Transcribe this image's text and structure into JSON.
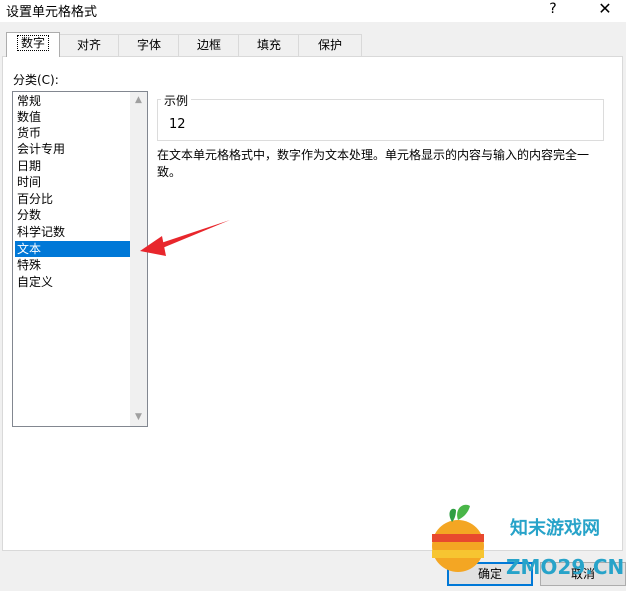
{
  "window": {
    "title": "设置单元格格式",
    "help": "?",
    "close": "✕"
  },
  "tabs": [
    {
      "label": "数字",
      "active": true
    },
    {
      "label": "对齐"
    },
    {
      "label": "字体"
    },
    {
      "label": "边框"
    },
    {
      "label": "填充"
    },
    {
      "label": "保护"
    }
  ],
  "category": {
    "label": "分类(C):",
    "items": [
      "常规",
      "数值",
      "货币",
      "会计专用",
      "日期",
      "时间",
      "百分比",
      "分数",
      "科学记数",
      "文本",
      "特殊",
      "自定义"
    ],
    "selected": "文本"
  },
  "sample": {
    "label": "示例",
    "value": "12"
  },
  "description": {
    "line1": "在文本单元格格式中，数字作为文本处理。单元格显示的内容与输入的内容完全一",
    "line2": "致。"
  },
  "buttons": {
    "ok": "确定",
    "cancel": "取消"
  },
  "watermark": {
    "line1": "知末游戏网",
    "line2": "ZMO29.CN"
  },
  "colors": {
    "selection": "#0078d7",
    "arrow": "#e8262c"
  }
}
